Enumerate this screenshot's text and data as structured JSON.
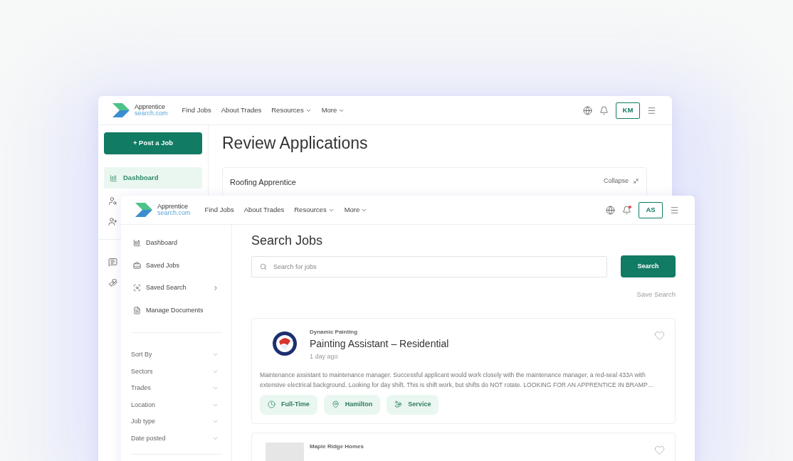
{
  "back_window": {
    "brand": {
      "name": "Apprentice",
      "domain": "search.com"
    },
    "nav": [
      {
        "label": "Find Jobs",
        "dropdown": false
      },
      {
        "label": "About Trades",
        "dropdown": false
      },
      {
        "label": "Resources",
        "dropdown": true
      },
      {
        "label": "More",
        "dropdown": true
      }
    ],
    "notification_dot": false,
    "avatar": "KM",
    "post_button": "+ Post a Job",
    "sidebar": [
      {
        "label": "Dashboard",
        "selected": true
      }
    ],
    "title": "Review Applications",
    "card": {
      "title": "Roofing Apprentice",
      "action": "Collapse"
    }
  },
  "front_window": {
    "brand": {
      "name": "Apprentice",
      "domain": "search.com"
    },
    "nav": [
      {
        "label": "Find Jobs",
        "dropdown": false
      },
      {
        "label": "About Trades",
        "dropdown": false
      },
      {
        "label": "Resources",
        "dropdown": true
      },
      {
        "label": "More",
        "dropdown": true
      }
    ],
    "notification_dot": true,
    "avatar": "AS",
    "sidebar": [
      {
        "label": "Dashboard",
        "kind": "dashboard",
        "submenu": false,
        "selected": false
      },
      {
        "label": "Saved Jobs",
        "kind": "briefcase",
        "submenu": false,
        "selected": false
      },
      {
        "label": "Saved Search",
        "kind": "search",
        "submenu": true,
        "selected": false
      },
      {
        "label": "Manage Documents",
        "kind": "document",
        "submenu": false,
        "selected": false
      }
    ],
    "filters": [
      "Sort By",
      "Sectors",
      "Trades",
      "Location",
      "Job type",
      "Date posted"
    ],
    "title": "Search Jobs",
    "search": {
      "placeholder": "Search for jobs",
      "button": "Search"
    },
    "save_search": {
      "label": "Save Search",
      "disabled": true
    },
    "jobs": [
      {
        "company": "Dynamic Painting",
        "title": "Painting Assistant – Residential",
        "posted": "1 day ago",
        "logo": {
          "kind": "badge"
        },
        "favorite": false,
        "description": "Maintenance assistant to maintenance manager. Successful applicant would work closely with the maintenance manager, a red-seal 433A with extensive electrical background. Looking for day shift. This is shift work, but shifts do NOT rotate. LOOKING FOR AN APPRENTICE IN BRAMP…",
        "tags": [
          {
            "kind": "clock",
            "label": "Full-Time"
          },
          {
            "kind": "pin",
            "label": "Hamilton"
          },
          {
            "kind": "service",
            "label": "Service"
          }
        ]
      },
      {
        "company": "Maple Ridge Homes",
        "logo": {
          "kind": "placeholder"
        },
        "favorite": false
      }
    ]
  }
}
